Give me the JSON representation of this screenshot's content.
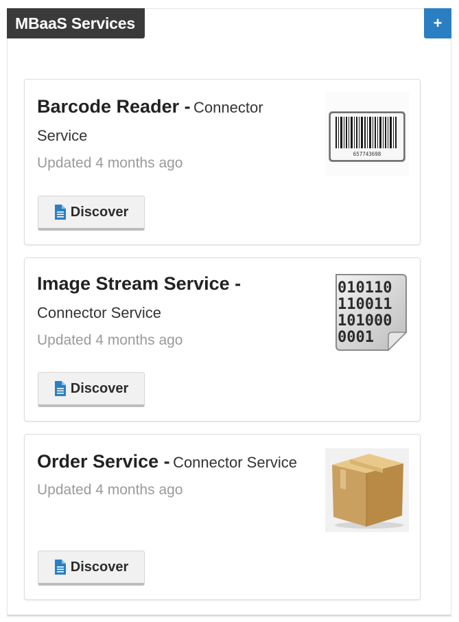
{
  "panel": {
    "title": "MBaaS Services",
    "add_label": "+"
  },
  "services": [
    {
      "name": "Barcode Reader -",
      "type": "Connector Service",
      "updated": "Updated 4 months ago",
      "discover_label": "Discover",
      "image_icon": "barcode-icon",
      "barcode_digits": "657743698"
    },
    {
      "name": "Image Stream Service -",
      "type": "Connector Service",
      "updated": "Updated 4 months ago",
      "discover_label": "Discover",
      "image_icon": "binary-file-icon",
      "binary_lines": [
        "010110",
        "110011",
        "101000",
        "0001"
      ]
    },
    {
      "name": "Order Service -",
      "type": "Connector Service",
      "updated": "Updated 4 months ago",
      "discover_label": "Discover",
      "image_icon": "cardboard-box-icon"
    }
  ],
  "colors": {
    "header_bg": "#3a3a3a",
    "accent_blue": "#2a7fc3",
    "muted_text": "#9a9a9a"
  }
}
